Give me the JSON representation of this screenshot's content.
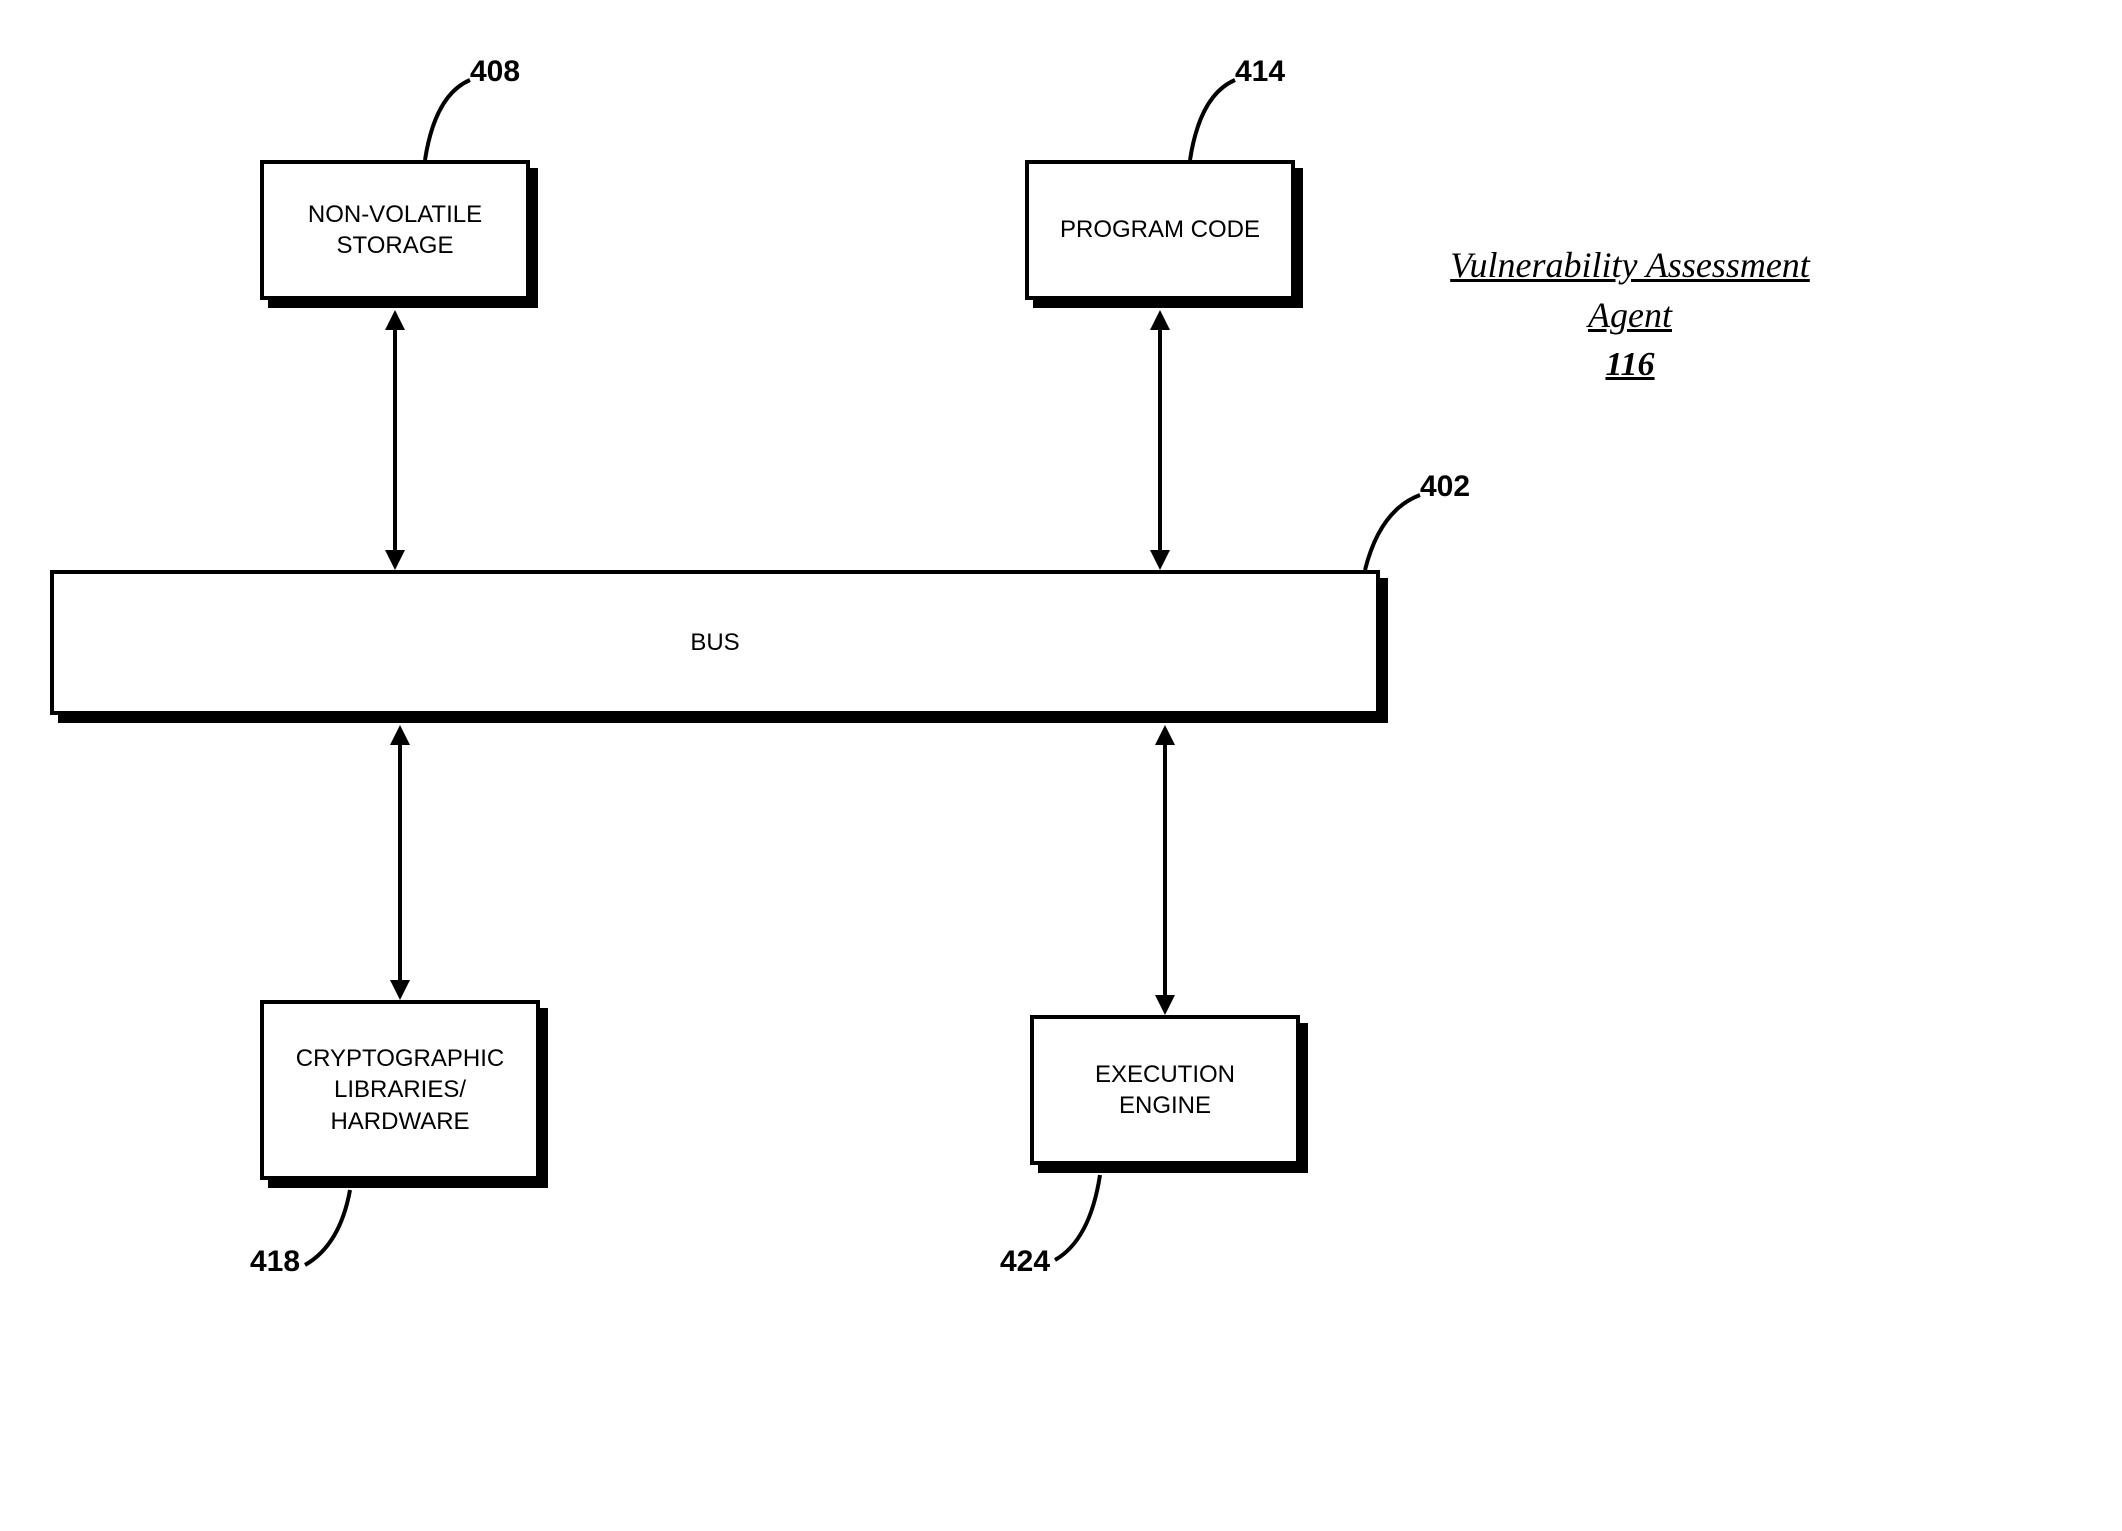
{
  "diagram": {
    "title_line1": "Vulnerability Assessment",
    "title_line2": "Agent",
    "title_ref": "116",
    "boxes": {
      "nonvolatile": {
        "label": "NON-VOLATILE\nSTORAGE",
        "ref": "408"
      },
      "programcode": {
        "label": "PROGRAM CODE",
        "ref": "414"
      },
      "bus": {
        "label": "BUS",
        "ref": "402"
      },
      "crypto": {
        "label": "CRYPTOGRAPHIC\nLIBRARIES/\nHARDWARE",
        "ref": "418"
      },
      "execution": {
        "label": "EXECUTION\nENGINE",
        "ref": "424"
      }
    }
  }
}
